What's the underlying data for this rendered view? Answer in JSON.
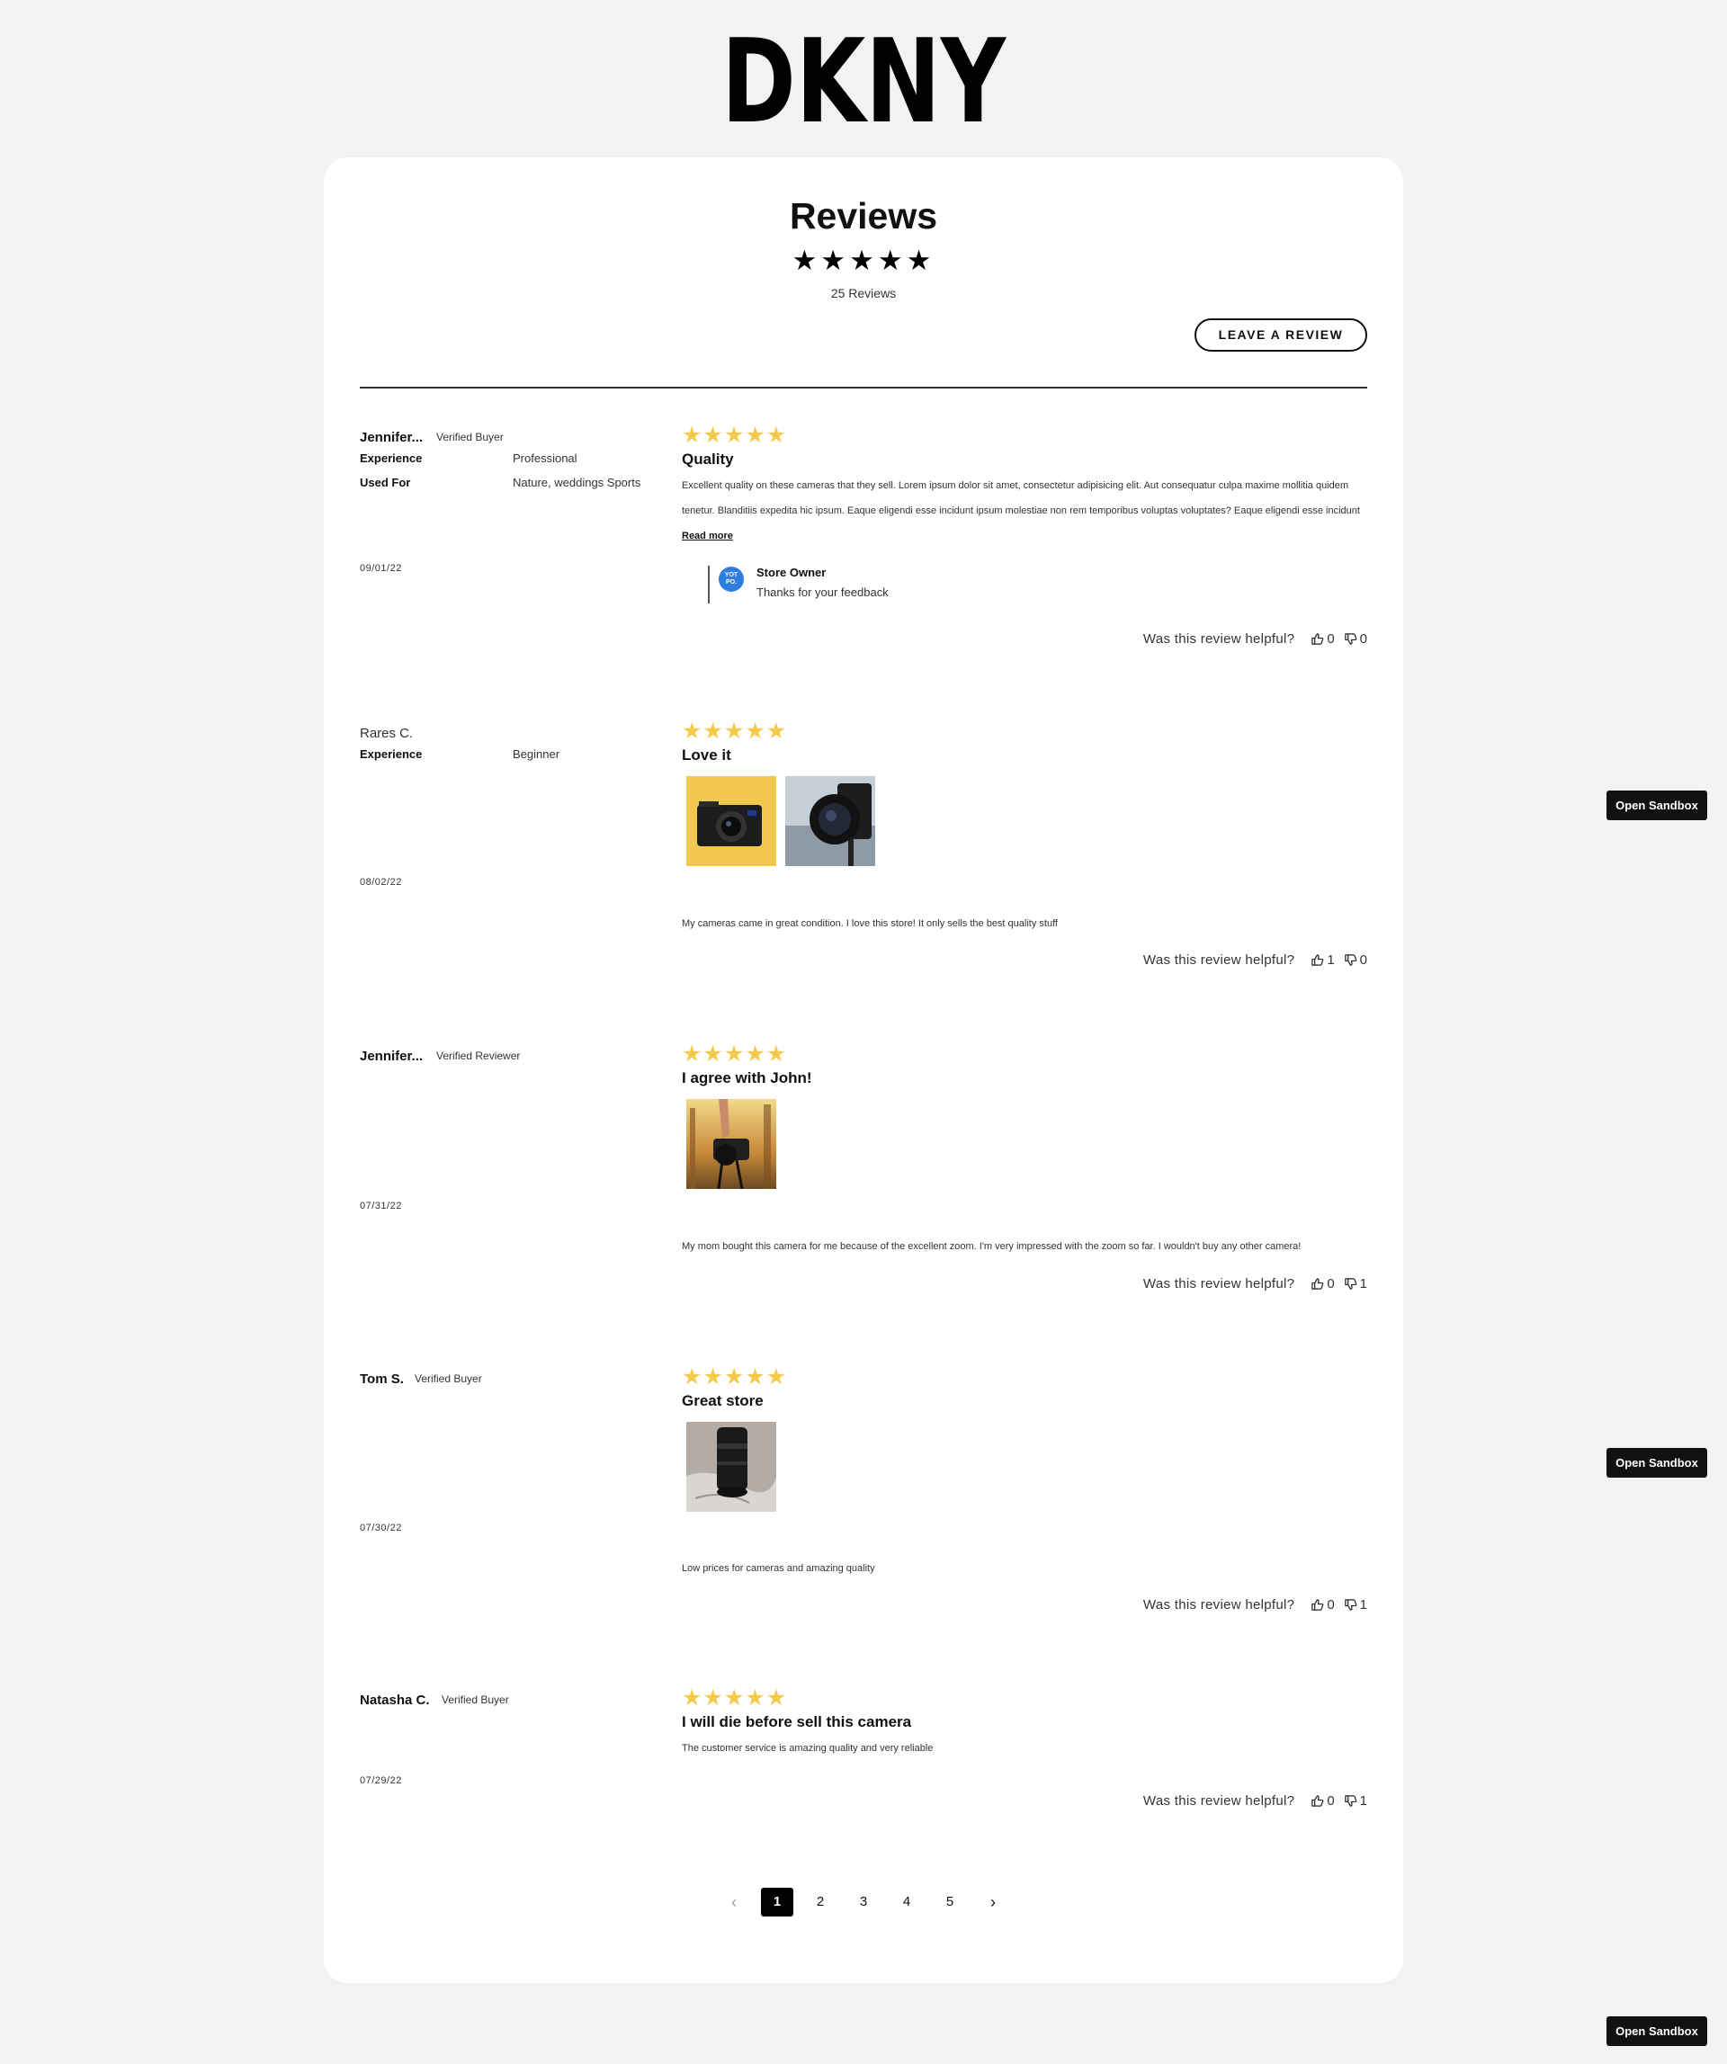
{
  "brand": "DKNY",
  "header": {
    "title": "Reviews",
    "stars": "★★★★★",
    "count": "25 Reviews",
    "leave_review": "LEAVE A REVIEW"
  },
  "reviews": [
    {
      "name": "Jennifer...",
      "badge": "Verified Buyer",
      "attrs": [
        {
          "k": "Experience",
          "v": "Professional"
        },
        {
          "k": "Used For",
          "v": "Nature, weddings Sports"
        }
      ],
      "date": "09/01/22",
      "stars": "★★★★★",
      "rating": 5,
      "title": "Quality",
      "body": "Excellent quality on these cameras that they sell. Lorem ipsum dolor sit amet, consectetur adipisicing elit. Aut consequatur culpa maxime mollitia quidem tenetur. Blanditiis expedita hic ipsum. Eaque eligendi esse incidunt ipsum molestiae non rem temporibus voluptas voluptates?  Eaque eligendi esse incidunt",
      "read_more": "Read more",
      "owner": {
        "avatar": "YOT PO.",
        "name": "Store Owner",
        "msg": "Thanks for your feedback"
      },
      "helpful": "Was this review helpful?",
      "up": "0",
      "down": "0"
    },
    {
      "name": "Rares C.",
      "badge": "",
      "attrs": [
        {
          "k": "Experience",
          "v": "Beginner"
        }
      ],
      "date": "08/02/22",
      "stars": "★★★★★",
      "rating": 5,
      "title": "Love it",
      "body": "My cameras came in great condition. I love this store! It only sells the best quality stuff",
      "helpful": "Was this review helpful?",
      "up": "1",
      "down": "0"
    },
    {
      "name": "Jennifer...",
      "badge": "Verified Reviewer",
      "date": "07/31/22",
      "stars": "★★★★★",
      "rating": 5,
      "title": "I agree with John!",
      "body": "My mom bought this camera for me because of the excellent zoom. I'm very impressed with the zoom so far. I wouldn't buy any other camera!",
      "helpful": "Was this review helpful?",
      "up": "0",
      "down": "1"
    },
    {
      "name": "Tom S.",
      "badge": "Verified Buyer",
      "date": "07/30/22",
      "stars": "★★★★★",
      "rating": 5,
      "title": "Great store",
      "body": "Low prices for cameras and amazing quality",
      "helpful": "Was this review helpful?",
      "up": "0",
      "down": "1"
    },
    {
      "name": "Natasha C.",
      "badge": "Verified Buyer",
      "date": "07/29/22",
      "stars": "★★★★★",
      "rating": 5,
      "title": "I will die before sell this camera",
      "body": "The customer service is amazing quality and very reliable",
      "helpful": "Was this review helpful?",
      "up": "0",
      "down": "1"
    }
  ],
  "pagination": {
    "prev": "‹",
    "pages": [
      "1",
      "2",
      "3",
      "4",
      "5"
    ],
    "current": "1",
    "next": "›"
  },
  "sandbox_label": "Open Sandbox",
  "colors": {
    "star": "#f5c94a",
    "owner_avatar": "#2e7de0",
    "background": "#f2f2f2"
  }
}
